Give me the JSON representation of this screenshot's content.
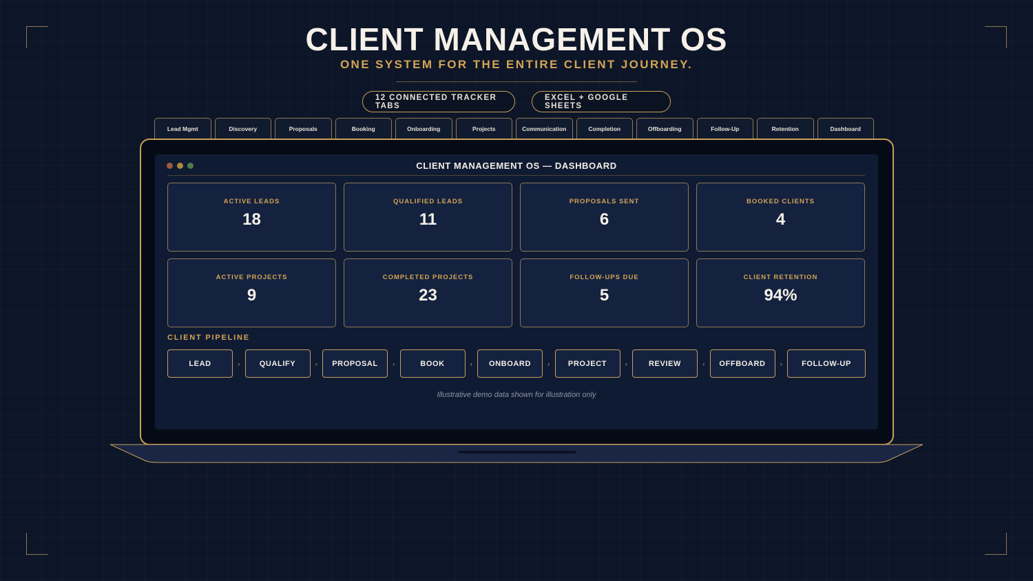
{
  "header": {
    "title": "CLIENT MANAGEMENT OS",
    "subtitle": "ONE SYSTEM FOR THE ENTIRE CLIENT JOURNEY.",
    "pills": [
      "12 CONNECTED TRACKER TABS",
      "EXCEL + GOOGLE SHEETS"
    ]
  },
  "tabs": [
    "Lead Mgmt",
    "Discovery",
    "Proposals",
    "Booking",
    "Onboarding",
    "Projects",
    "Communication",
    "Completion",
    "Offboarding",
    "Follow-Up",
    "Retention",
    "Dashboard"
  ],
  "window": {
    "title": "CLIENT MANAGEMENT OS — DASHBOARD"
  },
  "stats": [
    {
      "label": "ACTIVE LEADS",
      "value": "18"
    },
    {
      "label": "QUALIFIED LEADS",
      "value": "11"
    },
    {
      "label": "PROPOSALS SENT",
      "value": "6"
    },
    {
      "label": "BOOKED CLIENTS",
      "value": "4"
    },
    {
      "label": "ACTIVE PROJECTS",
      "value": "9"
    },
    {
      "label": "COMPLETED PROJECTS",
      "value": "23"
    },
    {
      "label": "FOLLOW-UPS DUE",
      "value": "5"
    },
    {
      "label": "CLIENT RETENTION",
      "value": "94%"
    }
  ],
  "pipeline": {
    "title": "CLIENT PIPELINE",
    "arrow": "›",
    "stages": [
      "LEAD",
      "QUALIFY",
      "PROPOSAL",
      "BOOK",
      "ONBOARD",
      "PROJECT",
      "REVIEW",
      "OFFBOARD",
      "FOLLOW-UP"
    ]
  },
  "footnote": "Illustrative demo data shown for illustration only",
  "colors": {
    "background": "#0d1628",
    "gold": "#c9a05a",
    "accent_text": "#d4a454",
    "panel": "#14223f"
  }
}
